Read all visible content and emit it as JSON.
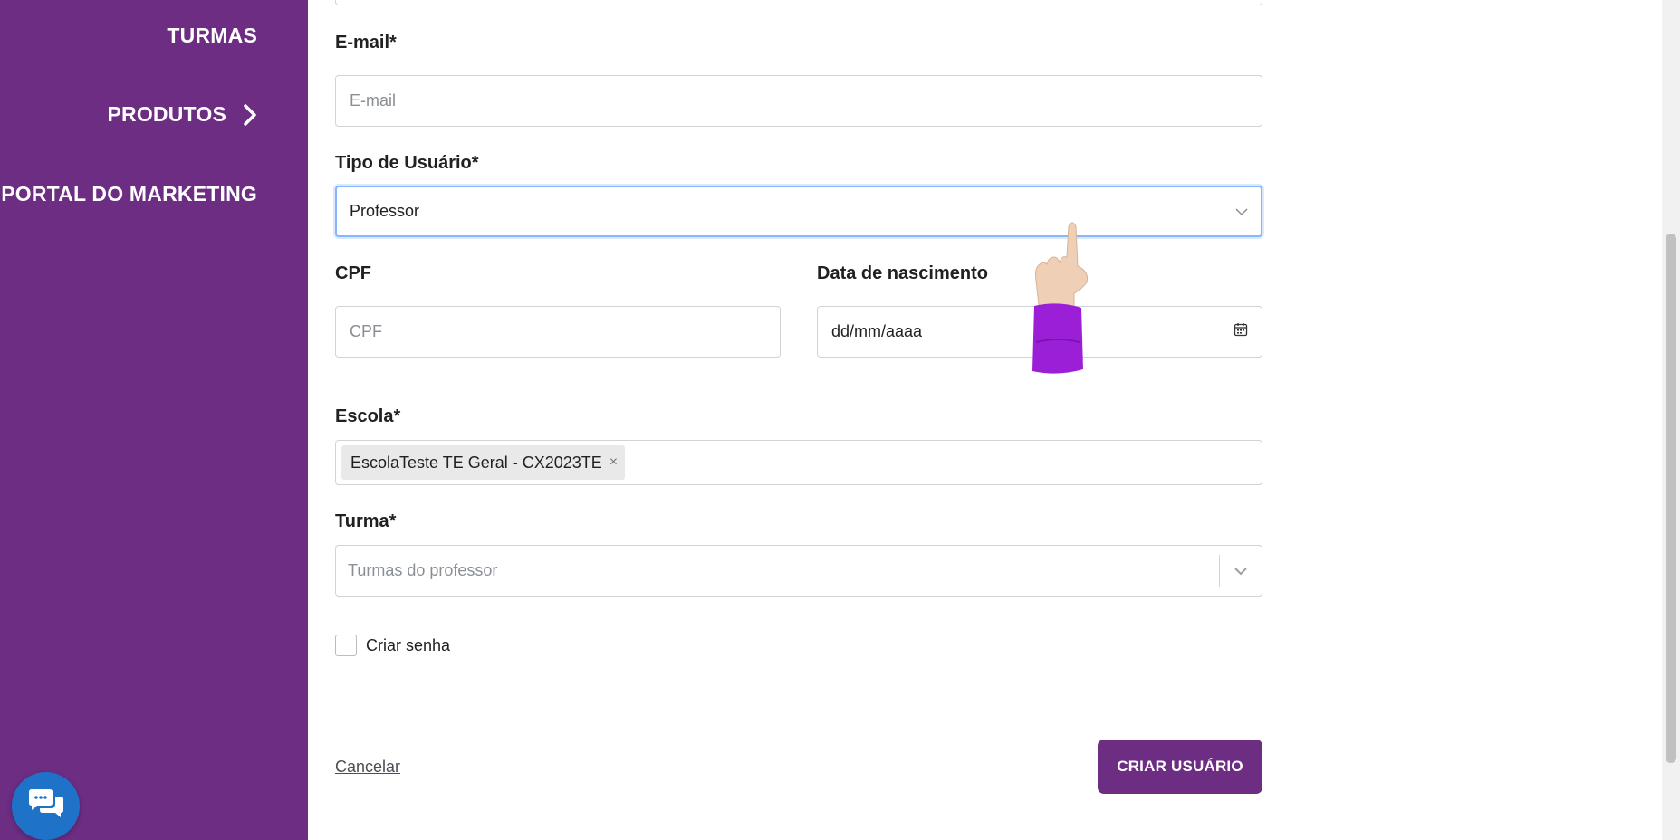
{
  "sidebar": {
    "items": [
      {
        "label": "TURMAS"
      },
      {
        "label": "PRODUTOS",
        "icon": "chevron-right-icon"
      },
      {
        "label": "PORTAL DO MARKETING"
      }
    ],
    "chat_icon": "chat-bubbles-icon"
  },
  "form": {
    "email": {
      "label": "E-mail*",
      "placeholder": "E-mail"
    },
    "tipo_usuario": {
      "label": "Tipo de Usuário*",
      "value": "Professor",
      "icon": "chevron-down-icon"
    },
    "cpf": {
      "label": "CPF",
      "placeholder": "CPF"
    },
    "nascimento": {
      "label": "Data de nascimento",
      "value": "dd/mm/aaaa",
      "icon": "calendar-icon"
    },
    "escola": {
      "label": "Escola*",
      "chips": [
        {
          "label": "EscolaTeste TE Geral - CX2023TE",
          "remove": "×"
        }
      ]
    },
    "turma": {
      "label": "Turma*",
      "placeholder": "Turmas do professor",
      "icon": "chevron-down-icon"
    },
    "criar_senha": {
      "label": "Criar senha",
      "checked": false
    }
  },
  "actions": {
    "cancel": "Cancelar",
    "submit": "CRIAR USUÁRIO"
  },
  "colors": {
    "sidebar_bg": "#6c2d83",
    "primary_button": "#6c2d83",
    "chat_button": "#1e73c9",
    "focus_border": "#86b7fe"
  },
  "cursor": {
    "icon": "pointing-hand-cursor-icon"
  }
}
